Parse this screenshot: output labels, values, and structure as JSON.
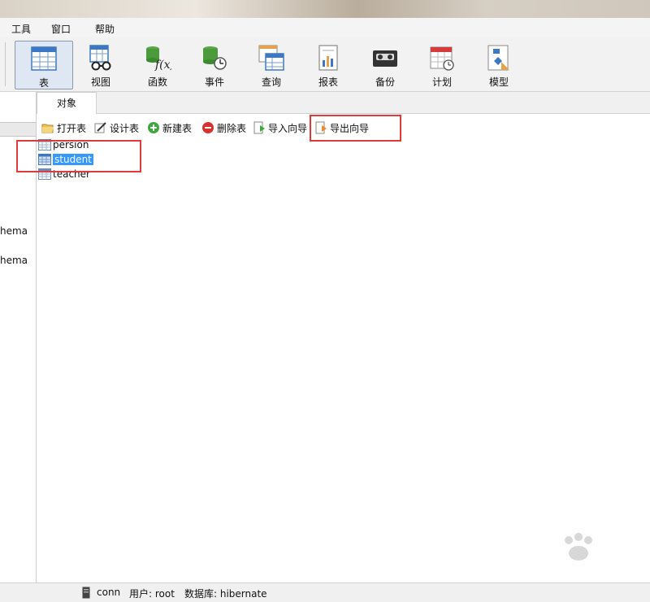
{
  "menu": {
    "items": [
      "工具",
      "窗口",
      "帮助"
    ]
  },
  "toolbar": {
    "buttons": [
      {
        "label": "表",
        "icon": "table-icon",
        "active": true
      },
      {
        "label": "视图",
        "icon": "view-icon"
      },
      {
        "label": "函数",
        "icon": "function-icon"
      },
      {
        "label": "事件",
        "icon": "event-icon"
      },
      {
        "label": "查询",
        "icon": "query-icon"
      },
      {
        "label": "报表",
        "icon": "report-icon"
      },
      {
        "label": "备份",
        "icon": "backup-icon"
      },
      {
        "label": "计划",
        "icon": "schedule-icon"
      },
      {
        "label": "模型",
        "icon": "model-icon"
      }
    ]
  },
  "left_panel": {
    "items": [
      "hema",
      "hema"
    ]
  },
  "tabs": {
    "objects": "对象"
  },
  "object_toolbar": {
    "open": "打开表",
    "design": "设计表",
    "new": "新建表",
    "delete": "删除表",
    "import": "导入向导",
    "export": "导出向导"
  },
  "tables": [
    {
      "name": "persion",
      "selected": false
    },
    {
      "name": "student",
      "selected": true
    },
    {
      "name": "teacher",
      "selected": false
    }
  ],
  "status": {
    "connection": "conn",
    "user": "用户: root",
    "database": "数据库: hibernate"
  },
  "colors": {
    "accent": "#3399ff",
    "highlight_box": "#e03a3a"
  }
}
